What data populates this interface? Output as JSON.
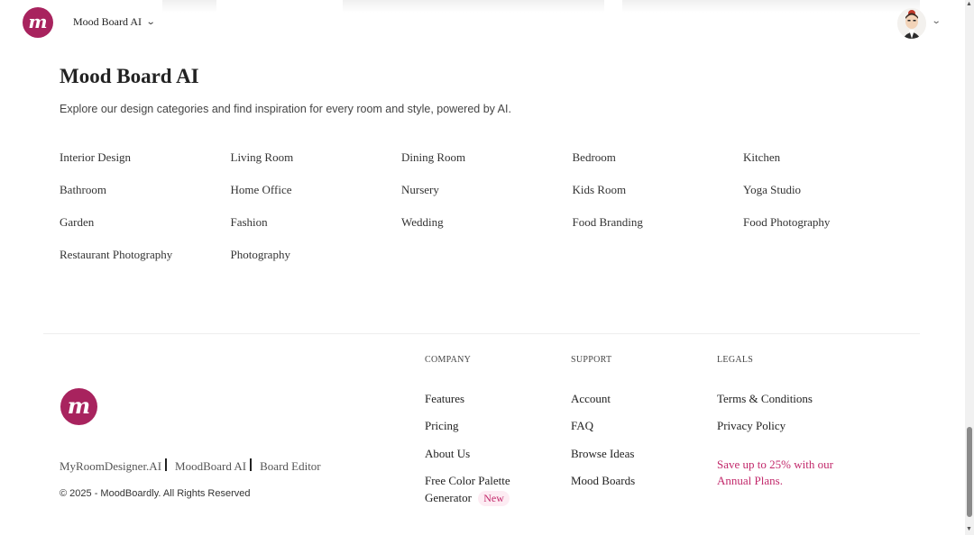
{
  "header": {
    "brand_switch": "Mood Board AI",
    "logo_letter": "m"
  },
  "main": {
    "title": "Mood Board AI",
    "subtitle": "Explore our design categories and find inspiration for every room and style, powered by AI.",
    "categories": [
      "Interior Design",
      "Living Room",
      "Dining Room",
      "Bedroom",
      "Kitchen",
      "Bathroom",
      "Home Office",
      "Nursery",
      "Kids Room",
      "Yoga Studio",
      "Garden",
      "Fashion",
      "Wedding",
      "Food Branding",
      "Food Photography",
      "Restaurant Photography",
      "Photography"
    ]
  },
  "footer": {
    "logo_letter": "m",
    "sites": [
      "MyRoomDesigner.AI",
      "MoodBoard AI",
      "Board Editor"
    ],
    "copyright": "© 2025 - MoodBoardly. All Rights Reserved",
    "company": {
      "heading": "COMPANY",
      "links": [
        "Features",
        "Pricing",
        "About Us"
      ],
      "palette_label": "Free Color Palette",
      "palette_label_2": "Generator",
      "new_badge": "New"
    },
    "support": {
      "heading": "SUPPORT",
      "links": [
        "Account",
        "FAQ",
        "Browse Ideas",
        "Mood Boards"
      ]
    },
    "legals": {
      "heading": "LEGALS",
      "links": [
        "Terms & Conditions",
        "Privacy Policy"
      ],
      "promo": "Save up to 25% with our Annual Plans."
    }
  },
  "icons": {
    "chevron": "chevron-down-icon",
    "avatar": "user-avatar"
  },
  "colors": {
    "brand": "#a8235e",
    "accent_text": "#c2296b",
    "badge_bg": "#fdecf3"
  }
}
